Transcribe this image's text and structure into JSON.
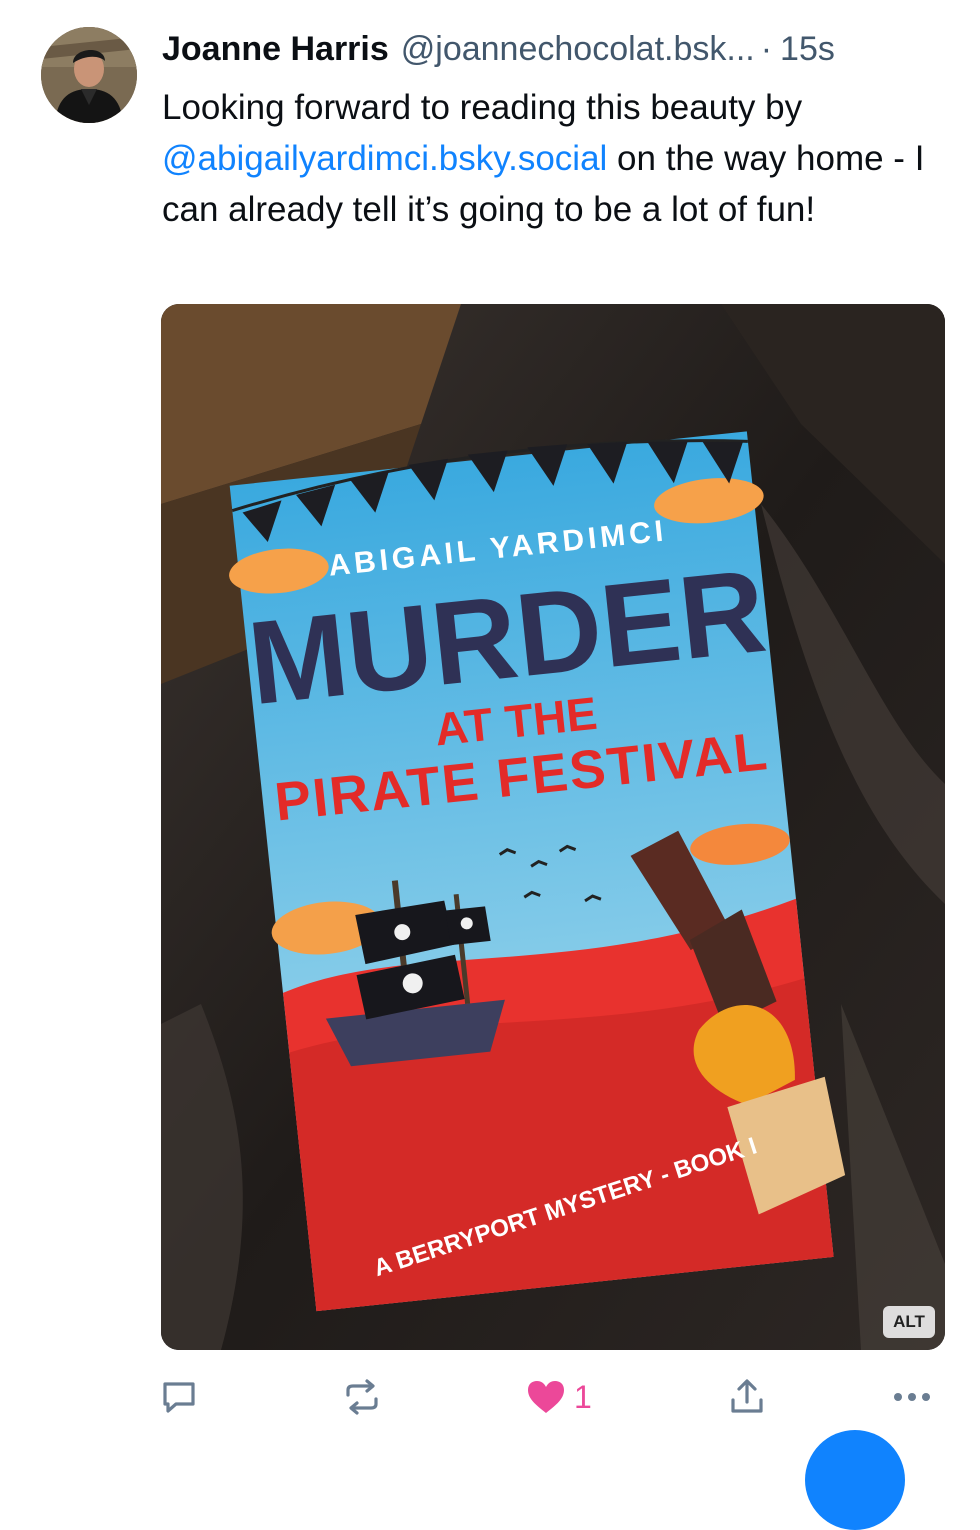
{
  "post": {
    "author": {
      "display_name": "Joanne Harris",
      "handle": "@joannechocolat.bsk...",
      "separator": "·",
      "time": "15s"
    },
    "text_before": "Looking forward to reading this beauty by ",
    "mention": "@abigailyardimci.bsky.social",
    "text_after": " on the way home - I can already tell it’s going to be a lot of fun!",
    "image": {
      "alt_badge": "ALT",
      "book": {
        "author": "ABIGAIL YARDIMCI",
        "title_main": "MURDER",
        "title_line2": "AT THE",
        "title_line3": "PIRATE FESTIVAL",
        "series": "A BERRYPORT MYSTERY - BOOK I"
      }
    },
    "actions": {
      "reply_icon": "reply-icon",
      "repost_icon": "repost-icon",
      "like_icon": "heart-icon",
      "like_count": "1",
      "share_icon": "share-icon",
      "more_icon": "more-icon"
    }
  },
  "colors": {
    "link": "#1083fe",
    "like": "#ec4899",
    "muted": "#42576c"
  }
}
